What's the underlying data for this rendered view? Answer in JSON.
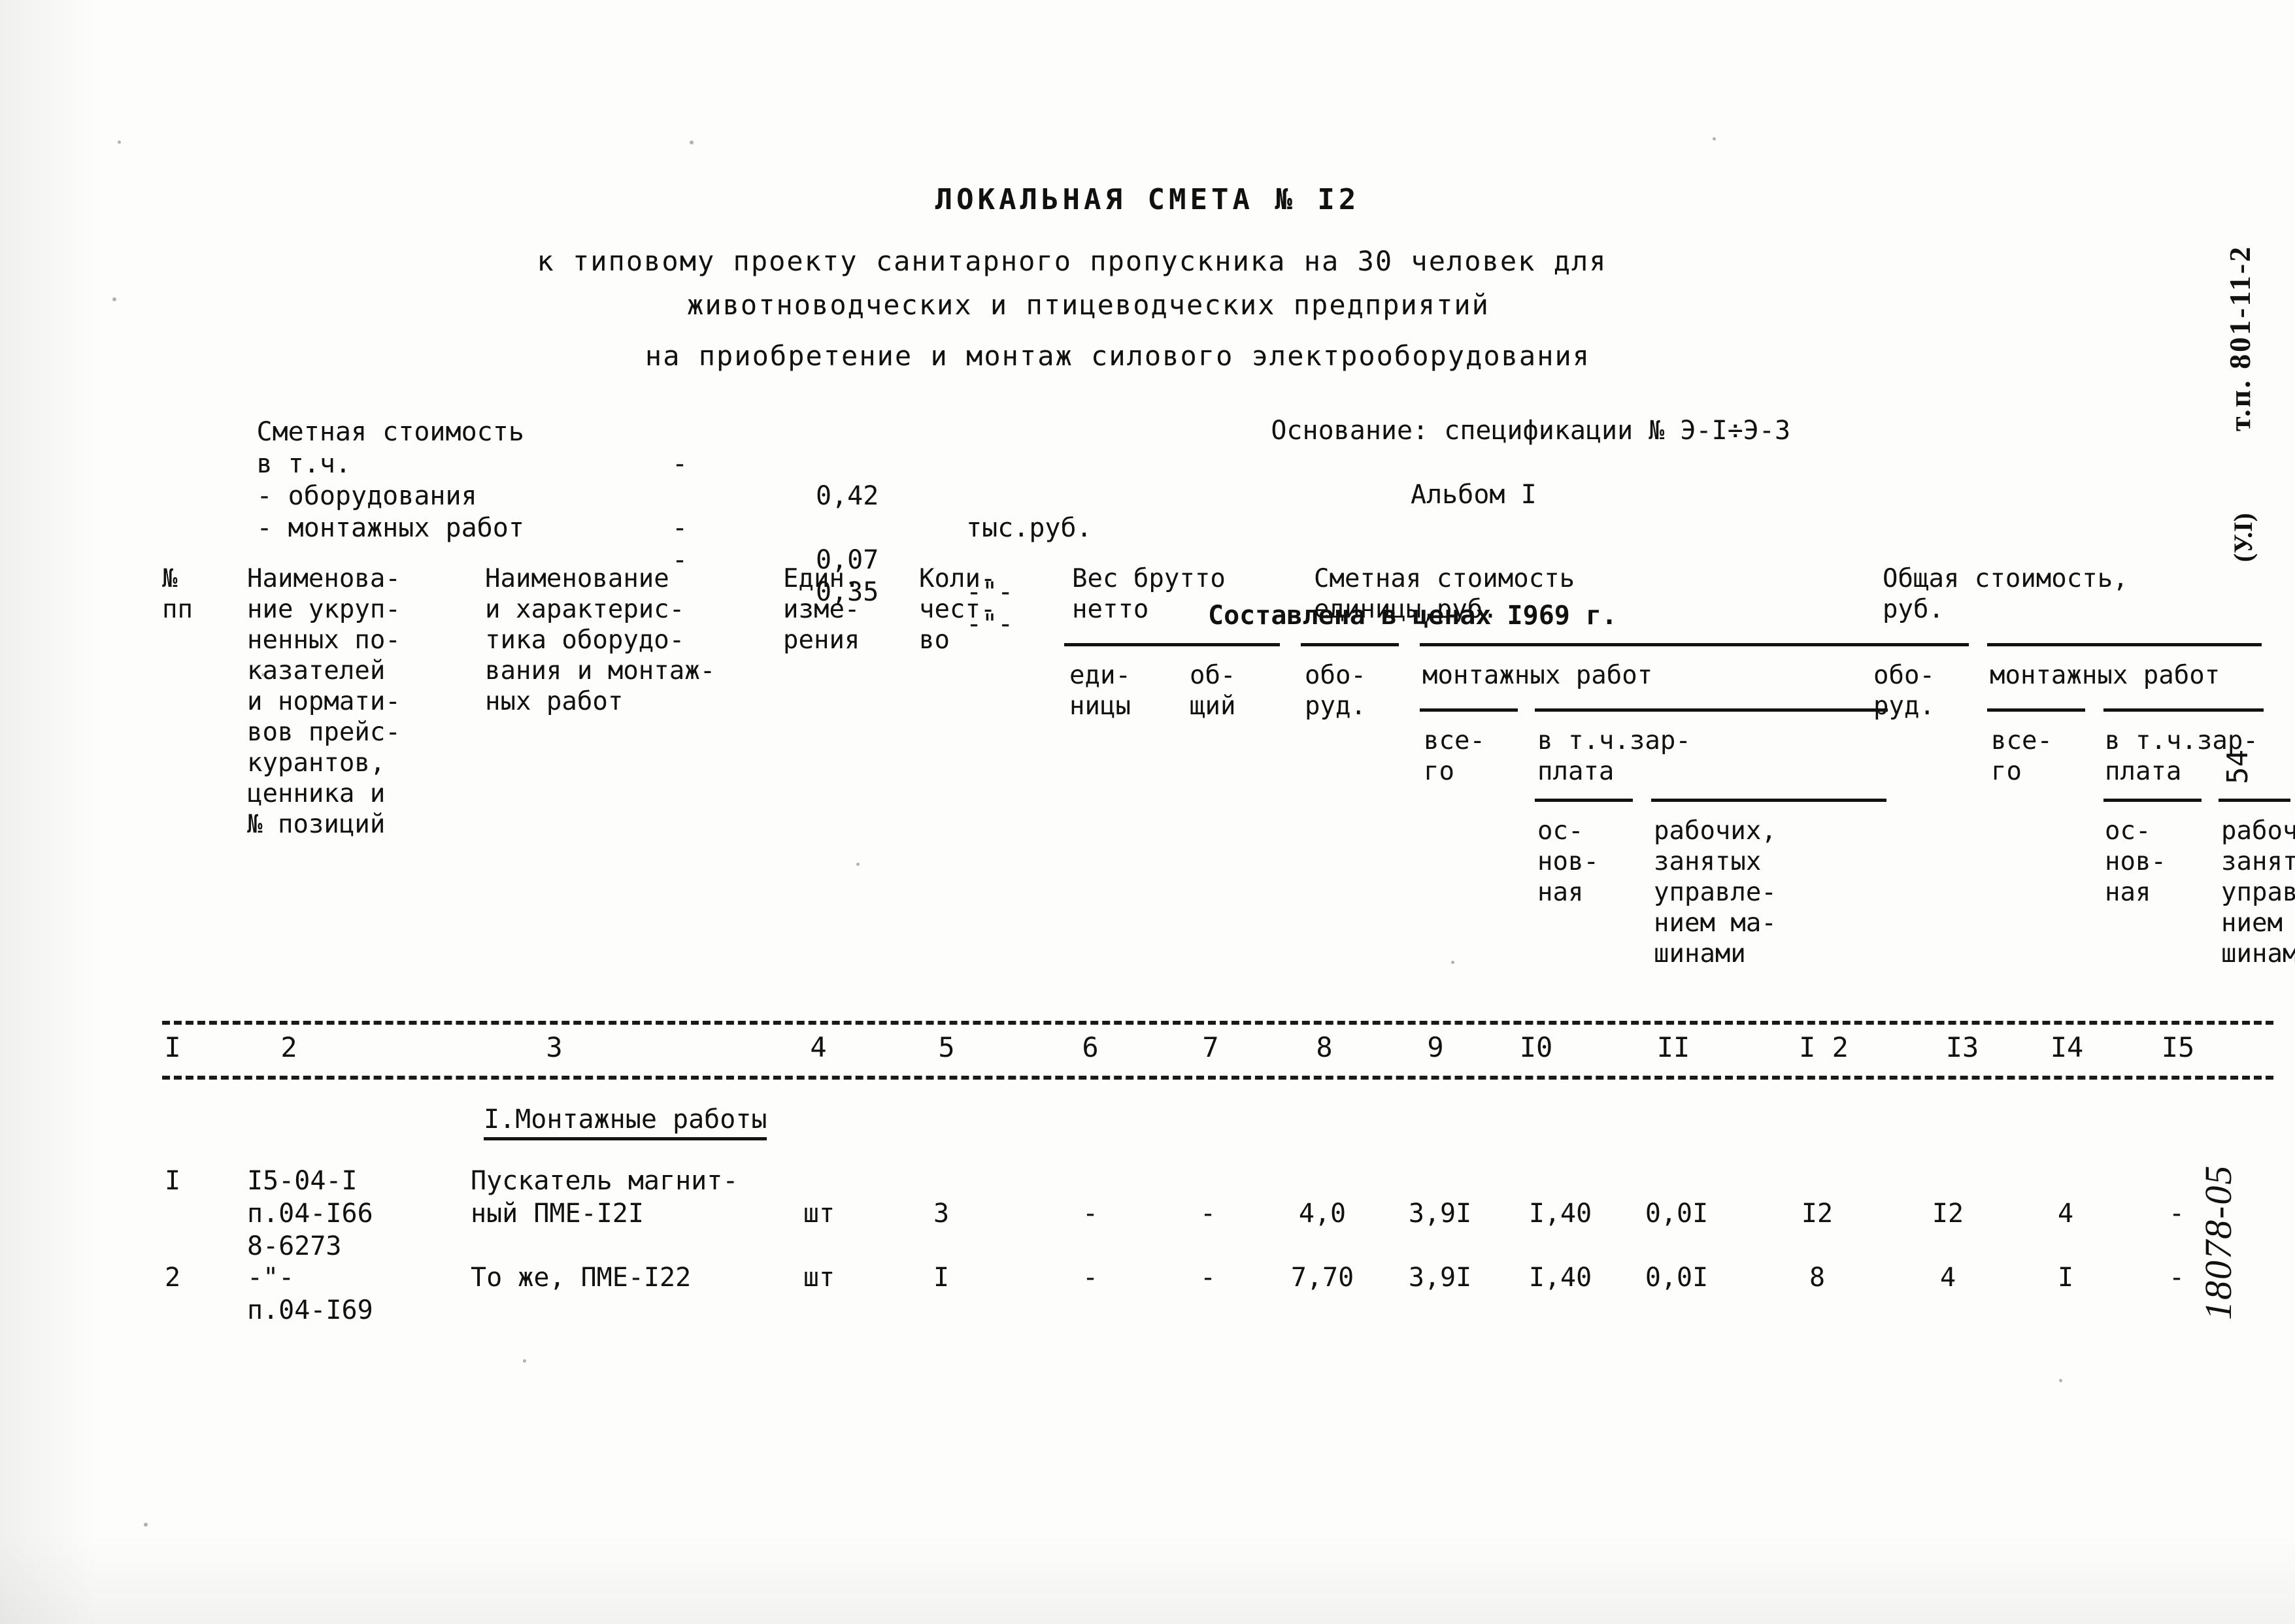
{
  "document": {
    "title": "ЛОКАЛЬНАЯ СМЕТА № I2",
    "subtitle_line1": "к типовому проекту санитарного пропускника на 30 человек для",
    "subtitle_line2": "животноводческих и птицеводческих предприятий",
    "subtitle_line3": "на приобретение и монтаж силового электрооборудования"
  },
  "summary": {
    "total_label": "Сметная стоимость",
    "total_dash": "-",
    "total_value": "0,42",
    "total_unit": "тыс.руб.",
    "including_label": "в т.ч.",
    "equipment_label": "- оборудования",
    "equipment_dash": "-",
    "equipment_value": "0,07",
    "equipment_unit": "-\"-",
    "install_label": "- монтажных работ",
    "install_dash": "-",
    "install_value": "0,35",
    "install_unit": "-\"-"
  },
  "basis": {
    "line1": "Основание: спецификации № Э-I÷Э-3",
    "album": "Альбом I",
    "prices": "Составлена в ценах I969 г."
  },
  "table": {
    "headers": {
      "col1": "№\nпп",
      "col2": "Наименова-\nние укруп-\nненных по-\nказателей\nи нормати-\nвов прейс-\nкурантов,\nценника и\n№ позиций",
      "col3": "Наименование\nи характерис-\nтика оборудо-\nвания и монтаж-\nных работ",
      "col4": "Един.\nизме-\nрения",
      "col5": "Коли-\nчест-\nво",
      "group_weight": "Вес брутто\nнетто",
      "col6": "еди-\nницы",
      "col7": "об-\nщий",
      "group_unit_cost": "Сметная стоимость\nединицы,руб.",
      "col8": "обо-\nруд.",
      "group_install_unit": "монтажных работ",
      "col9": "все-\nго",
      "col10_a": "в т.ч.зар-\nплата",
      "col10": "ос-\nнов-\nная",
      "col11": "рабочих,\nзанятых\nуправле-\nнием ма-\nшинами",
      "group_total_cost": "Общая стоимость,\nруб.",
      "col12": "обо-\nруд.",
      "group_install_total": "монтажных работ",
      "col13": "все-\nго",
      "col14_a": "в т.ч.зар-\nплата",
      "col14": "ос-\nнов-\nная",
      "col15": "рабочих,\nзанятых\nуправле-\nнием ма-\nшинами"
    },
    "column_numbers": [
      "I",
      "2",
      "3",
      "4",
      "5",
      "6",
      "7",
      "8",
      "9",
      "I0",
      "II",
      "I 2",
      "I3",
      "I4",
      "I5"
    ],
    "section_title": "I.Монтажные работы",
    "rows": [
      {
        "no": "I",
        "code": "I5-04-I\nп.04-I66\n8-6273",
        "name": "Пускатель магнит-\nный ПМЕ-I2I",
        "unit": "шт",
        "qty": "3",
        "weight_unit": "-",
        "weight_total": "-",
        "unit_equipment": "4,0",
        "unit_install_all": "3,9I",
        "unit_salary_main": "I,40",
        "unit_salary_machine": "0,0I",
        "total_equipment": "I2",
        "total_install_all": "I2",
        "total_salary_main": "4",
        "total_salary_machine": "-"
      },
      {
        "no": "2",
        "code": "-\"-\nп.04-I69",
        "name": "То же, ПМЕ-I22",
        "unit": "шт",
        "qty": "I",
        "weight_unit": "-",
        "weight_total": "-",
        "unit_equipment": "7,70",
        "unit_install_all": "3,9I",
        "unit_salary_main": "I,40",
        "unit_salary_machine": "0,0I",
        "total_equipment": "8",
        "total_install_all": "4",
        "total_salary_main": "I",
        "total_salary_machine": "-"
      }
    ]
  },
  "margin": {
    "project_code": "т.п. 801-11-2",
    "project_volume": "(У.I)",
    "page_number": "54",
    "archive_number": "18078-05"
  }
}
